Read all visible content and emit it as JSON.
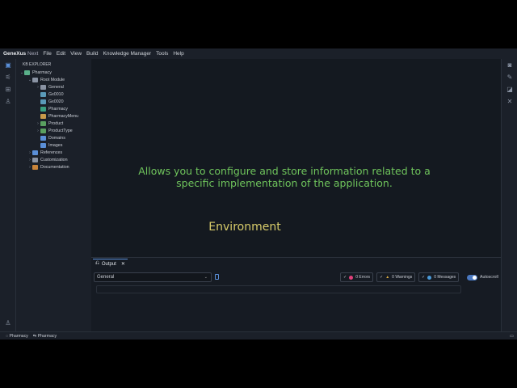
{
  "app": {
    "brand": "GeneXus",
    "brand_suffix": "Next"
  },
  "menu": [
    "File",
    "Edit",
    "View",
    "Build",
    "Knowledge Manager",
    "Tools",
    "Help"
  ],
  "sidebar": {
    "title": "KB EXPLORER",
    "tree": [
      {
        "label": "Pharmacy",
        "depth": 0,
        "chev": "v",
        "color": "#5ab08a"
      },
      {
        "label": "Root Module",
        "depth": 1,
        "chev": "v",
        "color": "#8a93a3"
      },
      {
        "label": "General",
        "depth": 2,
        "chev": ">",
        "color": "#8a93a3"
      },
      {
        "label": "Gx0010",
        "depth": 2,
        "chev": "",
        "color": "#5a9ab8"
      },
      {
        "label": "Gx0020",
        "depth": 2,
        "chev": "",
        "color": "#5a9ab8"
      },
      {
        "label": "Pharmacy",
        "depth": 2,
        "chev": "",
        "color": "#3aa080"
      },
      {
        "label": "PharmacyMenu",
        "depth": 2,
        "chev": "",
        "color": "#c89a4a"
      },
      {
        "label": "Product",
        "depth": 2,
        "chev": ">",
        "color": "#5aa060"
      },
      {
        "label": "ProductType",
        "depth": 2,
        "chev": ">",
        "color": "#5aa060"
      },
      {
        "label": "Domains",
        "depth": 2,
        "chev": "",
        "color": "#5a8fd8"
      },
      {
        "label": "Images",
        "depth": 2,
        "chev": "",
        "color": "#5a8fd8"
      },
      {
        "label": "References",
        "depth": 1,
        "chev": ">",
        "color": "#5a8fd8"
      },
      {
        "label": "Customization",
        "depth": 1,
        "chev": ">",
        "color": "#8a93a3"
      },
      {
        "label": "Documentation",
        "depth": 1,
        "chev": ">",
        "color": "#c8843a"
      }
    ]
  },
  "editor": {
    "description": "Allows you to configure and store information related to a specific implementation of the application.",
    "title": "Environment"
  },
  "output": {
    "tab": "Output",
    "select_value": "General",
    "errors": "0 Errors",
    "warnings": "0 Warnings",
    "messages": "0 Messages",
    "autoscroll": "Autoscroll",
    "autoscroll_on": true
  },
  "status": {
    "kb": "Pharmacy",
    "env": "Pharmacy"
  }
}
